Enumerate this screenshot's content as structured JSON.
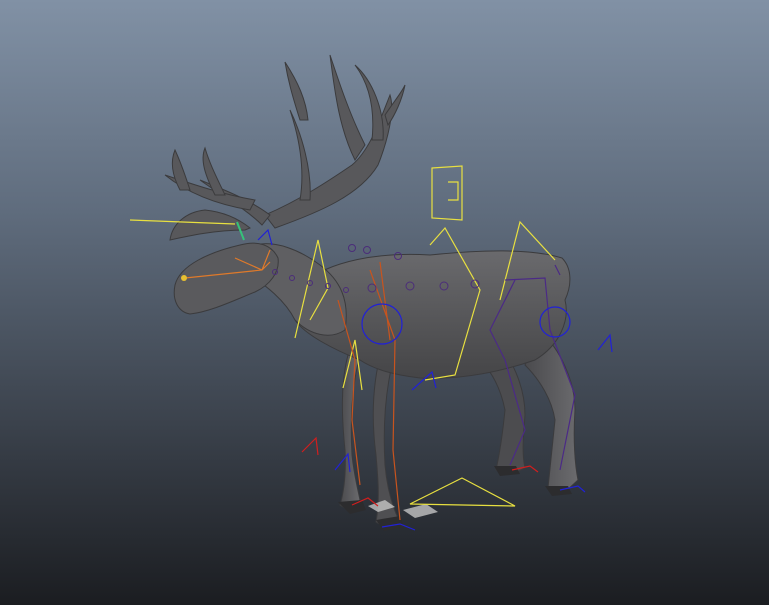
{
  "viewport": {
    "background_top": "#8191a5",
    "background_bottom": "#1b1d21"
  },
  "scene": {
    "model": "reindeer-mesh",
    "mesh_color": "#5a5a5c",
    "rig": {
      "control_colors": {
        "selected_curve": "#e8e040",
        "spine_joints": "#4b2d7a",
        "front_leg_chain": "#c8541e",
        "back_leg_chain": "#4b2a86",
        "left_side_controls": "#2121d6",
        "right_side_controls": "#d11e1e",
        "neck_jaw": "#e07a2a",
        "head_accent": "#36c27a"
      }
    }
  }
}
